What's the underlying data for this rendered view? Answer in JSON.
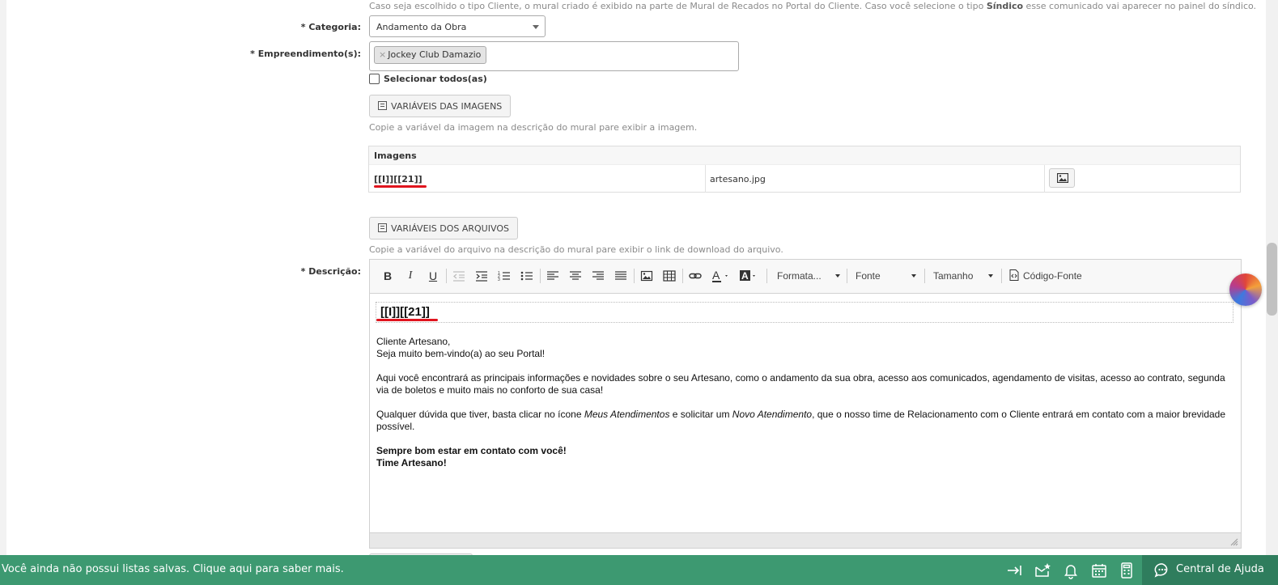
{
  "hints": {
    "top": "Caso seja escolhido o tipo Cliente, o mural criado é exibido na parte de Mural de Recados no Portal do Cliente. Caso você selecione o tipo ",
    "top_bold": "Síndico",
    "top_end": " esse comunicado vai aparecer no painel do síndico.",
    "images": "Copie a variável da imagem na descrição do mural pare exibir a imagem.",
    "files": "Copie a variável do arquivo na descrição do mural pare exibir o link de download do arquivo."
  },
  "form": {
    "categoria_label": "* Categoria:",
    "categoria_value": "Andamento da Obra",
    "empreendimento_label": "* Empreendimento(s):",
    "empreendimento_tag": "Jockey Club Damazio",
    "tag_remove": "×",
    "selecionar_todos": "Selecionar todos(as)",
    "descricao_label": "* Descrição:"
  },
  "buttons": {
    "variaveis_imagens": "VARIÁVEIS DAS IMAGENS",
    "variaveis_arquivos": "VARIÁVEIS DOS ARQUIVOS"
  },
  "images_table": {
    "header": "Imagens",
    "rows": [
      {
        "variable": "[[I]][[21]]",
        "filename": "artesano.jpg"
      }
    ]
  },
  "toolbar": {
    "bold": "B",
    "italic": "I",
    "underline": "U",
    "format": "Formata...",
    "font": "Fonte",
    "size": "Tamanho",
    "source": "Código-Fonte"
  },
  "editor": {
    "placeholder_var": "[[I]][[21]]",
    "p1_line1": "Cliente Artesano,",
    "p1_line2": "Seja muito bem-vindo(a) ao seu Portal!",
    "p2": "Aqui você encontrará as principais informações e novidades sobre o seu Artesano, como o andamento da sua obra, acesso aos comunicados, agendamento de visitas, acesso ao contrato, segunda via de boletos e muito mais no conforto de sua casa!",
    "p3_a": "Qualquer dúvida que tiver, basta clicar no ícone ",
    "p3_em1": "Meus Atendimentos",
    "p3_b": " e solicitar um ",
    "p3_em2": "Novo Atendimento",
    "p3_c": ", que o nosso time de Relacionamento com o Cliente entrará em contato com a maior brevidade possível.",
    "p4_line1": "Sempre bom estar em contato com você!",
    "p4_line2": "Time Artesano!"
  },
  "footer": {
    "message": "Você ainda não possui listas salvas. Clique aqui para saber mais.",
    "help": "Central de Ajuda"
  },
  "colors": {
    "footer_bg": "#3d9971",
    "help_bg": "#2f7d5d",
    "underline_red": "#e0141e"
  },
  "icons": [
    "collapse-arrow-icon",
    "mail-star-icon",
    "bell-icon",
    "calendar-icon",
    "calculator-icon",
    "chat-icon",
    "image-icon",
    "align-icon",
    "table-icon",
    "link-icon"
  ]
}
